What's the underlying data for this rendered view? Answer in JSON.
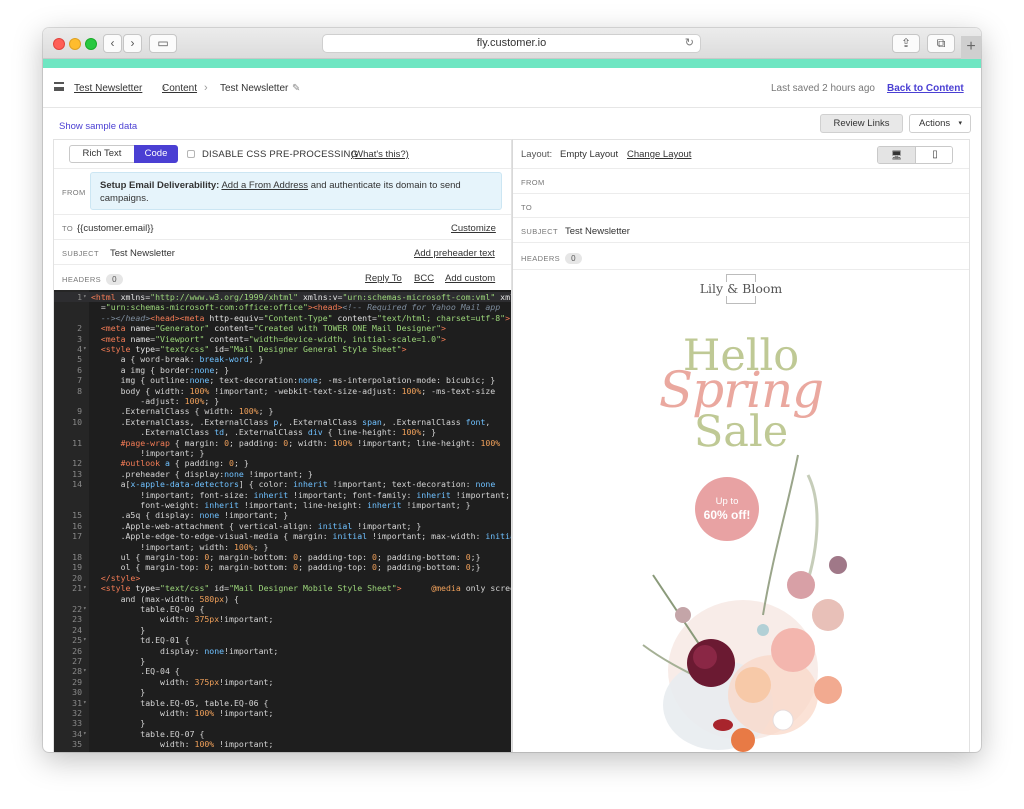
{
  "browser": {
    "url": "fly.customer.io",
    "reload_glyph": "↻",
    "back_glyph": "‹",
    "forward_glyph": "›",
    "sidebar_glyph": "▭",
    "share_glyph": "⇪",
    "tabs_glyph": "⧉",
    "newtab_glyph": "+"
  },
  "header": {
    "breadcrumb": [
      "Test Newsletter",
      "Content",
      "Test Newsletter"
    ],
    "separator": "›",
    "edit_glyph": "✎",
    "last_saved": "Last saved 2 hours ago",
    "back_link": "Back to Content"
  },
  "subbar": {
    "sample_link": "Show sample data",
    "review_button": "Review Links",
    "actions_button": "Actions",
    "actions_caret": "▾"
  },
  "editor_panel": {
    "mode_rich": "Rich Text",
    "mode_code": "Code",
    "disable_label": "DISABLE CSS PRE-PROCESSING",
    "whats_link": "(What's this?)",
    "from_label": "FROM",
    "deliverability": {
      "title": "Setup Email Deliverability:",
      "link": "Add a From Address",
      "rest": " and authenticate its domain to send campaigns."
    },
    "to_label": "TO",
    "to_value": "{{customer.email}}",
    "customize_link": "Customize",
    "subject_label": "SUBJECT",
    "subject_value": "Test Newsletter",
    "preheader_link": "Add preheader text",
    "headers_label": "HEADERS",
    "headers_count": "0",
    "reply_link": "Reply To",
    "bcc_link": "BCC",
    "custom_link": "Add custom"
  },
  "code_lines": [
    {
      "n": "1",
      "fold": true,
      "hl": true,
      "segs": [
        [
          "t-tag",
          "<html"
        ],
        [
          "t-attr",
          " xmlns"
        ],
        [
          "t-kw",
          "="
        ],
        [
          "t-str",
          "\"http://www.w3.org/1999/xhtml\""
        ],
        [
          "t-attr",
          " xmlns:v"
        ],
        [
          "t-kw",
          "="
        ],
        [
          "t-str",
          "\"urn:schemas-microsoft-com:vml\""
        ],
        [
          "t-attr",
          " xmlns:o"
        ]
      ]
    },
    {
      "n": "",
      "segs": [
        [
          "t-kw",
          "  ="
        ],
        [
          "t-str",
          "\"urn:schemas-microsoft-com:office:office\""
        ],
        [
          "t-tag",
          "><head>"
        ],
        [
          "t-com",
          "<!-- Required for Yahoo Mail app"
        ]
      ]
    },
    {
      "n": "",
      "segs": [
        [
          "t-com",
          "  --></head>"
        ],
        [
          "t-tag",
          "<head><meta"
        ],
        [
          "t-attr",
          " http-equiv"
        ],
        [
          "t-kw",
          "="
        ],
        [
          "t-str",
          "\"Content-Type\""
        ],
        [
          "t-attr",
          " content"
        ],
        [
          "t-kw",
          "="
        ],
        [
          "t-str",
          "\"text/html; charset=utf-8\""
        ],
        [
          "t-tag",
          ">"
        ]
      ]
    },
    {
      "n": "2",
      "segs": [
        [
          "t-tag",
          "  <meta"
        ],
        [
          "t-attr",
          " name"
        ],
        [
          "t-kw",
          "="
        ],
        [
          "t-str",
          "\"Generator\""
        ],
        [
          "t-attr",
          " content"
        ],
        [
          "t-kw",
          "="
        ],
        [
          "t-str",
          "\"Created with TOWER ONE Mail Designer\""
        ],
        [
          "t-tag",
          ">"
        ]
      ]
    },
    {
      "n": "3",
      "segs": [
        [
          "t-tag",
          "  <meta"
        ],
        [
          "t-attr",
          " name"
        ],
        [
          "t-kw",
          "="
        ],
        [
          "t-str",
          "\"Viewport\""
        ],
        [
          "t-attr",
          " content"
        ],
        [
          "t-kw",
          "="
        ],
        [
          "t-str",
          "\"width=device-width, initial-scale=1.0\""
        ],
        [
          "t-tag",
          ">"
        ]
      ]
    },
    {
      "n": "4",
      "fold": true,
      "segs": [
        [
          "t-tag",
          "  <style"
        ],
        [
          "t-attr",
          " type"
        ],
        [
          "t-kw",
          "="
        ],
        [
          "t-str",
          "\"text/css\""
        ],
        [
          "t-attr",
          " id"
        ],
        [
          "t-kw",
          "="
        ],
        [
          "t-str",
          "\"Mail Designer General Style Sheet\""
        ],
        [
          "t-tag",
          ">"
        ]
      ]
    },
    {
      "n": "5",
      "segs": [
        [
          "t-sel",
          "      a { "
        ],
        [
          "t-prop",
          "word-break"
        ],
        [
          "t-kw",
          ": "
        ],
        [
          "t-val",
          "break-word"
        ],
        [
          "t-kw",
          "; }"
        ]
      ]
    },
    {
      "n": "6",
      "segs": [
        [
          "t-sel",
          "      a img { "
        ],
        [
          "t-prop",
          "border"
        ],
        [
          "t-kw",
          ":"
        ],
        [
          "t-val",
          "none"
        ],
        [
          "t-kw",
          "; }"
        ]
      ]
    },
    {
      "n": "7",
      "segs": [
        [
          "t-sel",
          "      img { "
        ],
        [
          "t-prop",
          "outline"
        ],
        [
          "t-kw",
          ":"
        ],
        [
          "t-val",
          "none"
        ],
        [
          "t-kw",
          "; text-decoration:"
        ],
        [
          "t-val",
          "none"
        ],
        [
          "t-kw",
          "; -ms-interpolation-mode: bicubic; }"
        ]
      ]
    },
    {
      "n": "8",
      "segs": [
        [
          "t-sel",
          "      body { "
        ],
        [
          "t-prop",
          "width"
        ],
        [
          "t-kw",
          ": "
        ],
        [
          "t-unit",
          "100%"
        ],
        [
          "t-kw",
          " !important; -webkit-text-size-adjust: "
        ],
        [
          "t-unit",
          "100%"
        ],
        [
          "t-kw",
          "; -ms-text-size"
        ]
      ]
    },
    {
      "n": "",
      "segs": [
        [
          "t-kw",
          "          -adjust: "
        ],
        [
          "t-unit",
          "100%"
        ],
        [
          "t-kw",
          "; }"
        ]
      ]
    },
    {
      "n": "9",
      "segs": [
        [
          "t-sel",
          "      .ExternalClass { "
        ],
        [
          "t-prop",
          "width"
        ],
        [
          "t-kw",
          ": "
        ],
        [
          "t-unit",
          "100%"
        ],
        [
          "t-kw",
          "; }"
        ]
      ]
    },
    {
      "n": "10",
      "segs": [
        [
          "t-sel",
          "      .ExternalClass, .ExternalClass "
        ],
        [
          "t-val",
          "p"
        ],
        [
          "t-sel",
          ", .ExternalClass "
        ],
        [
          "t-val",
          "span"
        ],
        [
          "t-sel",
          ", .ExternalClass "
        ],
        [
          "t-val",
          "font"
        ],
        [
          "t-sel",
          ","
        ]
      ]
    },
    {
      "n": "",
      "segs": [
        [
          "t-sel",
          "          .ExternalClass "
        ],
        [
          "t-val",
          "td"
        ],
        [
          "t-sel",
          ", .ExternalClass "
        ],
        [
          "t-val",
          "div"
        ],
        [
          "t-kw",
          " { line-height: "
        ],
        [
          "t-unit",
          "100%"
        ],
        [
          "t-kw",
          "; }"
        ]
      ]
    },
    {
      "n": "11",
      "segs": [
        [
          "t-tag",
          "      #page-wrap"
        ],
        [
          "t-kw",
          " { margin: "
        ],
        [
          "t-unit",
          "0"
        ],
        [
          "t-kw",
          "; padding: "
        ],
        [
          "t-unit",
          "0"
        ],
        [
          "t-kw",
          "; width: "
        ],
        [
          "t-unit",
          "100%"
        ],
        [
          "t-kw",
          " !important; line-height: "
        ],
        [
          "t-unit",
          "100%"
        ]
      ]
    },
    {
      "n": "",
      "segs": [
        [
          "t-kw",
          "          !important; }"
        ]
      ]
    },
    {
      "n": "12",
      "segs": [
        [
          "t-tag",
          "      #outlook"
        ],
        [
          "t-val",
          " a"
        ],
        [
          "t-kw",
          " { padding: "
        ],
        [
          "t-unit",
          "0"
        ],
        [
          "t-kw",
          "; }"
        ]
      ]
    },
    {
      "n": "13",
      "segs": [
        [
          "t-sel",
          "      .preheader { "
        ],
        [
          "t-prop",
          "display"
        ],
        [
          "t-kw",
          ":"
        ],
        [
          "t-val",
          "none"
        ],
        [
          "t-kw",
          " !important; }"
        ]
      ]
    },
    {
      "n": "14",
      "segs": [
        [
          "t-sel",
          "      a["
        ],
        [
          "t-val",
          "x-apple-data-detectors"
        ],
        [
          "t-sel",
          "] { "
        ],
        [
          "t-prop",
          "color"
        ],
        [
          "t-kw",
          ": "
        ],
        [
          "t-val",
          "inherit"
        ],
        [
          "t-kw",
          " !important; text-decoration: "
        ],
        [
          "t-val",
          "none"
        ]
      ]
    },
    {
      "n": "",
      "segs": [
        [
          "t-kw",
          "          !important; font-size: "
        ],
        [
          "t-val",
          "inherit"
        ],
        [
          "t-kw",
          " !important; font-family: "
        ],
        [
          "t-val",
          "inherit"
        ],
        [
          "t-kw",
          " !important;"
        ]
      ]
    },
    {
      "n": "",
      "segs": [
        [
          "t-kw",
          "          font-weight: "
        ],
        [
          "t-val",
          "inherit"
        ],
        [
          "t-kw",
          " !important; line-height: "
        ],
        [
          "t-val",
          "inherit"
        ],
        [
          "t-kw",
          " !important; }"
        ]
      ]
    },
    {
      "n": "15",
      "segs": [
        [
          "t-sel",
          "      .a5q { "
        ],
        [
          "t-prop",
          "display"
        ],
        [
          "t-kw",
          ": "
        ],
        [
          "t-val",
          "none"
        ],
        [
          "t-kw",
          " !important; }"
        ]
      ]
    },
    {
      "n": "16",
      "segs": [
        [
          "t-sel",
          "      .Apple-web-attachment { "
        ],
        [
          "t-prop",
          "vertical-align"
        ],
        [
          "t-kw",
          ": "
        ],
        [
          "t-val",
          "initial"
        ],
        [
          "t-kw",
          " !important; }"
        ]
      ]
    },
    {
      "n": "17",
      "segs": [
        [
          "t-sel",
          "      .Apple-edge-to-edge-visual-media { "
        ],
        [
          "t-prop",
          "margin"
        ],
        [
          "t-kw",
          ": "
        ],
        [
          "t-val",
          "initial"
        ],
        [
          "t-kw",
          " !important; max-width: "
        ],
        [
          "t-val",
          "initial"
        ]
      ]
    },
    {
      "n": "",
      "segs": [
        [
          "t-kw",
          "          !important; width: "
        ],
        [
          "t-unit",
          "100%"
        ],
        [
          "t-kw",
          "; }"
        ]
      ]
    },
    {
      "n": "18",
      "segs": [
        [
          "t-sel",
          "      ul { "
        ],
        [
          "t-prop",
          "margin-top"
        ],
        [
          "t-kw",
          ": "
        ],
        [
          "t-unit",
          "0"
        ],
        [
          "t-kw",
          "; margin-bottom: "
        ],
        [
          "t-unit",
          "0"
        ],
        [
          "t-kw",
          "; padding-top: "
        ],
        [
          "t-unit",
          "0"
        ],
        [
          "t-kw",
          "; padding-bottom: "
        ],
        [
          "t-unit",
          "0"
        ],
        [
          "t-kw",
          ";}"
        ]
      ]
    },
    {
      "n": "19",
      "segs": [
        [
          "t-sel",
          "      ol { "
        ],
        [
          "t-prop",
          "margin-top"
        ],
        [
          "t-kw",
          ": "
        ],
        [
          "t-unit",
          "0"
        ],
        [
          "t-kw",
          "; margin-bottom: "
        ],
        [
          "t-unit",
          "0"
        ],
        [
          "t-kw",
          "; padding-top: "
        ],
        [
          "t-unit",
          "0"
        ],
        [
          "t-kw",
          "; padding-bottom: "
        ],
        [
          "t-unit",
          "0"
        ],
        [
          "t-kw",
          ";}"
        ]
      ]
    },
    {
      "n": "20",
      "segs": [
        [
          "t-tag",
          "  </style>"
        ]
      ]
    },
    {
      "n": "21",
      "fold": true,
      "segs": [
        [
          "t-tag",
          "  <style"
        ],
        [
          "t-attr",
          " type"
        ],
        [
          "t-kw",
          "="
        ],
        [
          "t-str",
          "\"text/css\""
        ],
        [
          "t-attr",
          " id"
        ],
        [
          "t-kw",
          "="
        ],
        [
          "t-str",
          "\"Mail Designer Mobile Style Sheet\""
        ],
        [
          "t-tag",
          ">"
        ],
        [
          "t-kw",
          "      "
        ],
        [
          "t-unit",
          "@media"
        ],
        [
          "t-kw",
          " only screen"
        ]
      ]
    },
    {
      "n": "",
      "segs": [
        [
          "t-kw",
          "      and (max-width: "
        ],
        [
          "t-unit",
          "580px"
        ],
        [
          "t-kw",
          ") {"
        ]
      ]
    },
    {
      "n": "22",
      "fold": true,
      "segs": [
        [
          "t-sel",
          "          table.EQ-00 {"
        ]
      ]
    },
    {
      "n": "23",
      "segs": [
        [
          "t-kw",
          "              width: "
        ],
        [
          "t-unit",
          "375px"
        ],
        [
          "t-kw",
          "!important;"
        ]
      ]
    },
    {
      "n": "24",
      "segs": [
        [
          "t-kw",
          "          }"
        ]
      ]
    },
    {
      "n": "25",
      "fold": true,
      "segs": [
        [
          "t-sel",
          "          td.EQ-01 {"
        ]
      ]
    },
    {
      "n": "26",
      "segs": [
        [
          "t-kw",
          "              display: "
        ],
        [
          "t-val",
          "none"
        ],
        [
          "t-kw",
          "!important;"
        ]
      ]
    },
    {
      "n": "27",
      "segs": [
        [
          "t-kw",
          "          }"
        ]
      ]
    },
    {
      "n": "28",
      "fold": true,
      "segs": [
        [
          "t-sel",
          "          .EQ-04 {"
        ]
      ]
    },
    {
      "n": "29",
      "segs": [
        [
          "t-kw",
          "              width: "
        ],
        [
          "t-unit",
          "375px"
        ],
        [
          "t-kw",
          "!important;"
        ]
      ]
    },
    {
      "n": "30",
      "segs": [
        [
          "t-kw",
          "          }"
        ]
      ]
    },
    {
      "n": "31",
      "fold": true,
      "segs": [
        [
          "t-sel",
          "          table.EQ-05, table.EQ-06 {"
        ]
      ]
    },
    {
      "n": "32",
      "segs": [
        [
          "t-kw",
          "              width: "
        ],
        [
          "t-unit",
          "100%"
        ],
        [
          "t-kw",
          " !important;"
        ]
      ]
    },
    {
      "n": "33",
      "segs": [
        [
          "t-kw",
          "          }"
        ]
      ]
    },
    {
      "n": "34",
      "fold": true,
      "segs": [
        [
          "t-sel",
          "          table.EQ-07 {"
        ]
      ]
    },
    {
      "n": "35",
      "segs": [
        [
          "t-kw",
          "              width: "
        ],
        [
          "t-unit",
          "100%"
        ],
        [
          "t-kw",
          " !important;"
        ]
      ]
    }
  ],
  "preview_panel": {
    "layout_label": "Layout:",
    "layout_value": "Empty Layout",
    "change_link": "Change Layout",
    "desktop_glyph": "🖥",
    "mobile_glyph": "▯",
    "from_label": "FROM",
    "to_label": "TO",
    "subject_label": "SUBJECT",
    "subject_value": "Test Newsletter",
    "headers_label": "HEADERS",
    "headers_count": "0"
  },
  "email": {
    "brand": "Lily & Bloom",
    "hello": "Hello",
    "spring": "Spring",
    "sale": "Sale",
    "badge_line1": "Up to",
    "badge_line2": "60% off!"
  },
  "colors": {
    "accent": "#4a3fd3",
    "top_stripe": "#6ee6c2",
    "editor_bg": "#1e1e1e",
    "hello_green": "#bfc995",
    "spring_pink": "#eaa89f",
    "badge_pink": "#e8a2a3"
  }
}
